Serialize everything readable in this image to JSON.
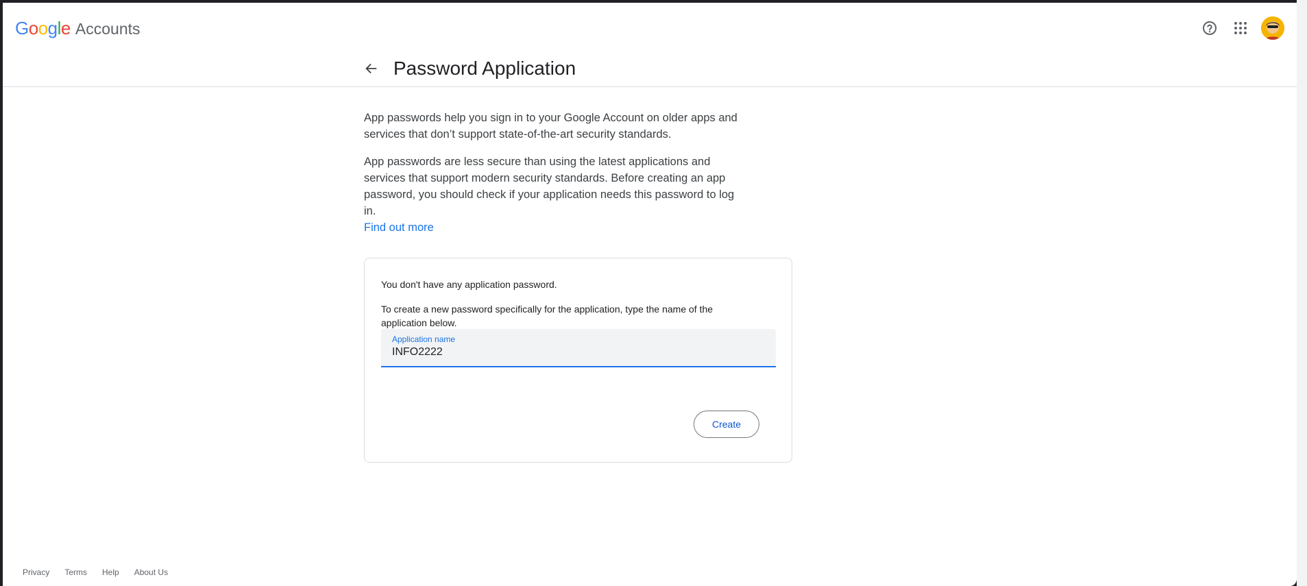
{
  "header": {
    "brand": "Google",
    "product": "Accounts"
  },
  "page": {
    "title": "Password Application",
    "intro_1": "App passwords help you sign in to your Google Account on older apps and services that don’t support state-of-the-art security standards.",
    "intro_2": "App passwords are less secure than using the latest applications and services that support modern security standards. Before creating an app password, you should check if your application needs this password to log in.",
    "find_out_more": "Find out more"
  },
  "card": {
    "no_passwords": "You don't have any application password.",
    "instructions": "To create a new password specifically for the application, type the name of the application below.",
    "field_label": "Application name",
    "field_value": "INFO2222",
    "create_label": "Create"
  },
  "footer": {
    "links": [
      "Privacy",
      "Terms",
      "Help",
      "About Us"
    ]
  },
  "icons": {
    "help": "help-circle-icon",
    "apps": "apps-grid-icon",
    "back": "arrow-back-icon"
  },
  "colors": {
    "accent": "#1a73e8",
    "button_text": "#0b57d0",
    "avatar_bg": "#f6b400"
  }
}
